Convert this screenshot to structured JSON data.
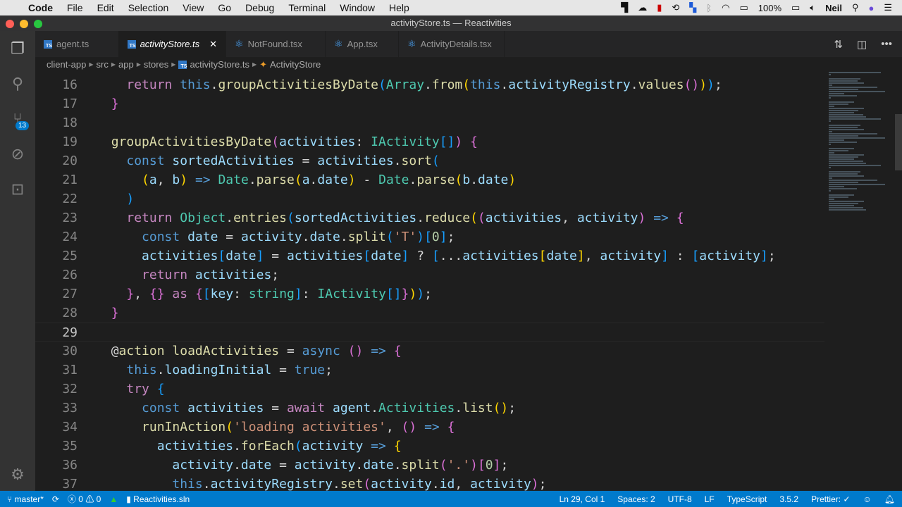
{
  "menubar": {
    "app": "Code",
    "items": [
      "File",
      "Edit",
      "Selection",
      "View",
      "Go",
      "Debug",
      "Terminal",
      "Window",
      "Help"
    ],
    "battery": "100%",
    "user": "Neil"
  },
  "window": {
    "title": "activityStore.ts — Reactivities"
  },
  "activity_bar": {
    "scm_badge": "13"
  },
  "tabs": [
    {
      "label": "agent.ts",
      "icon": "ts"
    },
    {
      "label": "activityStore.ts",
      "icon": "ts",
      "active": true
    },
    {
      "label": "NotFound.tsx",
      "icon": "react"
    },
    {
      "label": "App.tsx",
      "icon": "react"
    },
    {
      "label": "ActivityDetails.tsx",
      "icon": "react"
    }
  ],
  "breadcrumb": [
    "client-app",
    "src",
    "app",
    "stores",
    "activityStore.ts",
    "ActivityStore"
  ],
  "editor": {
    "current_line": 29,
    "lines": [
      {
        "n": "16",
        "t": [
          [
            "    ",
            ""
          ],
          [
            "return",
            "c"
          ],
          [
            " ",
            ""
          ],
          [
            "this",
            "k"
          ],
          [
            ".",
            "p"
          ],
          [
            "groupActivitiesByDate",
            "f"
          ],
          [
            "(",
            "b3"
          ],
          [
            "Array",
            "t"
          ],
          [
            ".",
            "p"
          ],
          [
            "from",
            "f"
          ],
          [
            "(",
            "b1"
          ],
          [
            "this",
            "k"
          ],
          [
            ".",
            "p"
          ],
          [
            "activityRegistry",
            "v"
          ],
          [
            ".",
            "p"
          ],
          [
            "values",
            "f"
          ],
          [
            "()",
            "b2"
          ],
          [
            ")",
            "b1"
          ],
          [
            ")",
            "b3"
          ],
          [
            ";",
            "p"
          ]
        ]
      },
      {
        "n": "17",
        "t": [
          [
            "  ",
            ""
          ],
          [
            "}",
            "b2"
          ]
        ]
      },
      {
        "n": "18",
        "t": []
      },
      {
        "n": "19",
        "t": [
          [
            "  ",
            ""
          ],
          [
            "groupActivitiesByDate",
            "f"
          ],
          [
            "(",
            "b2"
          ],
          [
            "activities",
            "v"
          ],
          [
            ": ",
            "p"
          ],
          [
            "IActivity",
            "t"
          ],
          [
            "[]",
            "b3"
          ],
          [
            ")",
            "b2"
          ],
          [
            " ",
            ""
          ],
          [
            "{",
            "b2"
          ]
        ]
      },
      {
        "n": "20",
        "t": [
          [
            "    ",
            ""
          ],
          [
            "const",
            "k"
          ],
          [
            " ",
            ""
          ],
          [
            "sortedActivities",
            "v"
          ],
          [
            " = ",
            "p"
          ],
          [
            "activities",
            "v"
          ],
          [
            ".",
            "p"
          ],
          [
            "sort",
            "f"
          ],
          [
            "(",
            "b3"
          ]
        ]
      },
      {
        "n": "21",
        "t": [
          [
            "      ",
            ""
          ],
          [
            "(",
            "b1"
          ],
          [
            "a",
            "v"
          ],
          [
            ", ",
            "p"
          ],
          [
            "b",
            "v"
          ],
          [
            ")",
            "b1"
          ],
          [
            " ",
            ""
          ],
          [
            "=>",
            "k"
          ],
          [
            " ",
            ""
          ],
          [
            "Date",
            "t"
          ],
          [
            ".",
            "p"
          ],
          [
            "parse",
            "f"
          ],
          [
            "(",
            "b1"
          ],
          [
            "a",
            "v"
          ],
          [
            ".",
            "p"
          ],
          [
            "date",
            "v"
          ],
          [
            ")",
            "b1"
          ],
          [
            " - ",
            "p"
          ],
          [
            "Date",
            "t"
          ],
          [
            ".",
            "p"
          ],
          [
            "parse",
            "f"
          ],
          [
            "(",
            "b1"
          ],
          [
            "b",
            "v"
          ],
          [
            ".",
            "p"
          ],
          [
            "date",
            "v"
          ],
          [
            ")",
            "b1"
          ]
        ]
      },
      {
        "n": "22",
        "t": [
          [
            "    ",
            ""
          ],
          [
            ")",
            "b3"
          ]
        ]
      },
      {
        "n": "23",
        "t": [
          [
            "    ",
            ""
          ],
          [
            "return",
            "c"
          ],
          [
            " ",
            ""
          ],
          [
            "Object",
            "t"
          ],
          [
            ".",
            "p"
          ],
          [
            "entries",
            "f"
          ],
          [
            "(",
            "b3"
          ],
          [
            "sortedActivities",
            "v"
          ],
          [
            ".",
            "p"
          ],
          [
            "reduce",
            "f"
          ],
          [
            "(",
            "b1"
          ],
          [
            "(",
            "b2"
          ],
          [
            "activities",
            "v"
          ],
          [
            ", ",
            "p"
          ],
          [
            "activity",
            "v"
          ],
          [
            ")",
            "b2"
          ],
          [
            " ",
            ""
          ],
          [
            "=>",
            "k"
          ],
          [
            " ",
            ""
          ],
          [
            "{",
            "b2"
          ]
        ]
      },
      {
        "n": "24",
        "t": [
          [
            "      ",
            ""
          ],
          [
            "const",
            "k"
          ],
          [
            " ",
            ""
          ],
          [
            "date",
            "v"
          ],
          [
            " = ",
            "p"
          ],
          [
            "activity",
            "v"
          ],
          [
            ".",
            "p"
          ],
          [
            "date",
            "v"
          ],
          [
            ".",
            "p"
          ],
          [
            "split",
            "f"
          ],
          [
            "(",
            "b3"
          ],
          [
            "'T'",
            "s"
          ],
          [
            ")",
            "b3"
          ],
          [
            "[",
            "b3"
          ],
          [
            "0",
            "n"
          ],
          [
            "]",
            "b3"
          ],
          [
            ";",
            "p"
          ]
        ]
      },
      {
        "n": "25",
        "t": [
          [
            "      ",
            ""
          ],
          [
            "activities",
            "v"
          ],
          [
            "[",
            "b3"
          ],
          [
            "date",
            "v"
          ],
          [
            "]",
            "b3"
          ],
          [
            " = ",
            "p"
          ],
          [
            "activities",
            "v"
          ],
          [
            "[",
            "b3"
          ],
          [
            "date",
            "v"
          ],
          [
            "]",
            "b3"
          ],
          [
            " ? ",
            "p"
          ],
          [
            "[",
            "b3"
          ],
          [
            "...",
            "p"
          ],
          [
            "activities",
            "v"
          ],
          [
            "[",
            "b1"
          ],
          [
            "date",
            "v"
          ],
          [
            "]",
            "b1"
          ],
          [
            ", ",
            "p"
          ],
          [
            "activity",
            "v"
          ],
          [
            "]",
            "b3"
          ],
          [
            " : ",
            "p"
          ],
          [
            "[",
            "b3"
          ],
          [
            "activity",
            "v"
          ],
          [
            "]",
            "b3"
          ],
          [
            ";",
            "p"
          ]
        ]
      },
      {
        "n": "26",
        "t": [
          [
            "      ",
            ""
          ],
          [
            "return",
            "c"
          ],
          [
            " ",
            ""
          ],
          [
            "activities",
            "v"
          ],
          [
            ";",
            "p"
          ]
        ]
      },
      {
        "n": "27",
        "t": [
          [
            "    ",
            ""
          ],
          [
            "}",
            "b2"
          ],
          [
            ", ",
            "p"
          ],
          [
            "{}",
            "b2"
          ],
          [
            " ",
            ""
          ],
          [
            "as",
            "c"
          ],
          [
            " ",
            ""
          ],
          [
            "{",
            "b2"
          ],
          [
            "[",
            "b3"
          ],
          [
            "key",
            "v"
          ],
          [
            ": ",
            "p"
          ],
          [
            "string",
            "t"
          ],
          [
            "]",
            "b3"
          ],
          [
            ": ",
            "p"
          ],
          [
            "IActivity",
            "t"
          ],
          [
            "[]",
            "b3"
          ],
          [
            "}",
            "b2"
          ],
          [
            ")",
            "b1"
          ],
          [
            ")",
            "b3"
          ],
          [
            ";",
            "p"
          ]
        ]
      },
      {
        "n": "28",
        "t": [
          [
            "  ",
            ""
          ],
          [
            "}",
            "b2"
          ]
        ]
      },
      {
        "n": "29",
        "t": []
      },
      {
        "n": "30",
        "t": [
          [
            "  ",
            ""
          ],
          [
            "@",
            "p"
          ],
          [
            "action",
            "d"
          ],
          [
            " ",
            ""
          ],
          [
            "loadActivities",
            "f"
          ],
          [
            " = ",
            "p"
          ],
          [
            "async",
            "k"
          ],
          [
            " ",
            ""
          ],
          [
            "()",
            "b2"
          ],
          [
            " ",
            ""
          ],
          [
            "=>",
            "k"
          ],
          [
            " ",
            ""
          ],
          [
            "{",
            "b2"
          ]
        ]
      },
      {
        "n": "31",
        "t": [
          [
            "    ",
            ""
          ],
          [
            "this",
            "k"
          ],
          [
            ".",
            "p"
          ],
          [
            "loadingInitial",
            "v"
          ],
          [
            " = ",
            "p"
          ],
          [
            "true",
            "k"
          ],
          [
            ";",
            "p"
          ]
        ]
      },
      {
        "n": "32",
        "t": [
          [
            "    ",
            ""
          ],
          [
            "try",
            "c"
          ],
          [
            " ",
            ""
          ],
          [
            "{",
            "b3"
          ]
        ]
      },
      {
        "n": "33",
        "t": [
          [
            "      ",
            ""
          ],
          [
            "const",
            "k"
          ],
          [
            " ",
            ""
          ],
          [
            "activities",
            "v"
          ],
          [
            " = ",
            "p"
          ],
          [
            "await",
            "c"
          ],
          [
            " ",
            ""
          ],
          [
            "agent",
            "v"
          ],
          [
            ".",
            "p"
          ],
          [
            "Activities",
            "t"
          ],
          [
            ".",
            "p"
          ],
          [
            "list",
            "f"
          ],
          [
            "()",
            "b1"
          ],
          [
            ";",
            "p"
          ]
        ]
      },
      {
        "n": "34",
        "t": [
          [
            "      ",
            ""
          ],
          [
            "runInAction",
            "f"
          ],
          [
            "(",
            "b1"
          ],
          [
            "'loading activities'",
            "s"
          ],
          [
            ", ",
            "p"
          ],
          [
            "()",
            "b2"
          ],
          [
            " ",
            ""
          ],
          [
            "=>",
            "k"
          ],
          [
            " ",
            ""
          ],
          [
            "{",
            "b2"
          ]
        ]
      },
      {
        "n": "35",
        "t": [
          [
            "        ",
            ""
          ],
          [
            "activities",
            "v"
          ],
          [
            ".",
            "p"
          ],
          [
            "forEach",
            "f"
          ],
          [
            "(",
            "b3"
          ],
          [
            "activity",
            "v"
          ],
          [
            " ",
            ""
          ],
          [
            "=>",
            "k"
          ],
          [
            " ",
            ""
          ],
          [
            "{",
            "b1"
          ]
        ]
      },
      {
        "n": "36",
        "t": [
          [
            "          ",
            ""
          ],
          [
            "activity",
            "v"
          ],
          [
            ".",
            "p"
          ],
          [
            "date",
            "v"
          ],
          [
            " = ",
            "p"
          ],
          [
            "activity",
            "v"
          ],
          [
            ".",
            "p"
          ],
          [
            "date",
            "v"
          ],
          [
            ".",
            "p"
          ],
          [
            "split",
            "f"
          ],
          [
            "(",
            "b2"
          ],
          [
            "'.'",
            "s"
          ],
          [
            ")",
            "b2"
          ],
          [
            "[",
            "b2"
          ],
          [
            "0",
            "n"
          ],
          [
            "]",
            "b2"
          ],
          [
            ";",
            "p"
          ]
        ]
      },
      {
        "n": "37",
        "t": [
          [
            "          ",
            ""
          ],
          [
            "this",
            "k"
          ],
          [
            ".",
            "p"
          ],
          [
            "activityRegistry",
            "v"
          ],
          [
            ".",
            "p"
          ],
          [
            "set",
            "f"
          ],
          [
            "(",
            "b2"
          ],
          [
            "activity",
            "v"
          ],
          [
            ".",
            "p"
          ],
          [
            "id",
            "v"
          ],
          [
            ", ",
            "p"
          ],
          [
            "activity",
            "v"
          ],
          [
            ")",
            "b2"
          ],
          [
            ";",
            "p"
          ]
        ]
      }
    ]
  },
  "status": {
    "branch": "master*",
    "errors": "0",
    "warnings": "0",
    "solution": "Reactivities.sln",
    "position": "Ln 29, Col 1",
    "spaces": "Spaces: 2",
    "encoding": "UTF-8",
    "eol": "LF",
    "language": "TypeScript",
    "ts_version": "3.5.2",
    "prettier": "Prettier: ✓"
  }
}
